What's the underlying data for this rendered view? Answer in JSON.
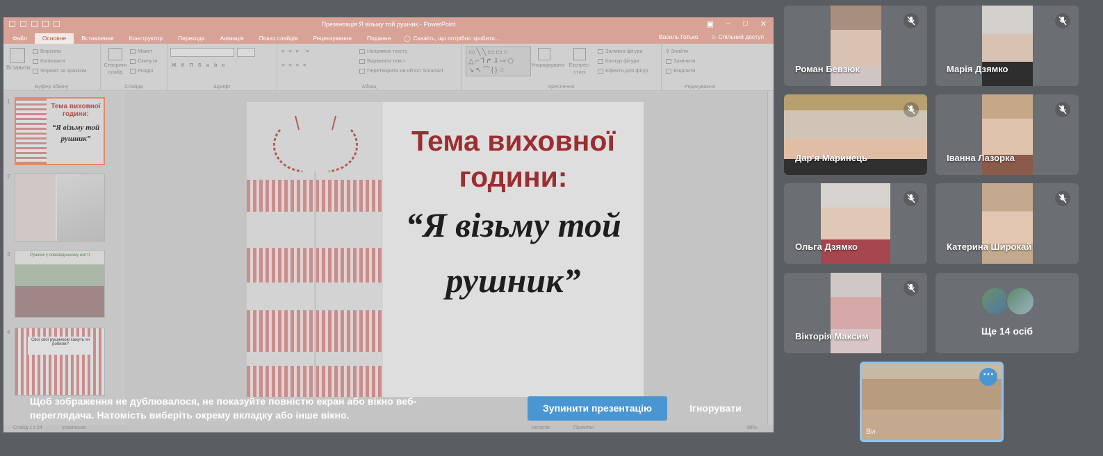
{
  "powerpoint": {
    "title": "Презентація Я візьму той рушник - PowerPoint",
    "tabs": [
      "Файл",
      "Основне",
      "Вставлення",
      "Конструктор",
      "Переходи",
      "Анімація",
      "Показ слайдів",
      "Рецензування",
      "Подання"
    ],
    "active_tab": "Основне",
    "tell_me": "Скажіть, що потрібно зробити...",
    "user": "Василь Готько",
    "share": "Спільний доступ",
    "ribbon": {
      "clipboard": {
        "paste": "Вставити",
        "cut": "Вирізати",
        "copy": "Копіювати",
        "format_painter": "Формат за зразком",
        "label": "Буфер обміну"
      },
      "slides": {
        "new_slide": "Створити слайд",
        "layout": "Макет",
        "reset": "Скинути",
        "section": "Розділ",
        "label": "Слайди"
      },
      "font": {
        "label": "Шрифт"
      },
      "paragraph": {
        "text_direction": "Напрямок тексту",
        "align_text": "Вирівняти текст",
        "convert_smartart": "Перетворити на об'єкт SmartArt",
        "label": "Абзац"
      },
      "drawing": {
        "arrange": "Упорядкувати",
        "quick_styles": "Експрес-стилі",
        "shape_fill": "Заливка фігури",
        "shape_outline": "Контур фігури",
        "shape_effects": "Ефекти для фігур",
        "label": "Креслення"
      },
      "editing": {
        "find": "Знайти",
        "replace": "Замінити",
        "select": "Виділити",
        "label": "Редагування"
      }
    },
    "slide_numbers": [
      "1",
      "2",
      "3",
      "4"
    ],
    "thumb1": {
      "title": "Тема виховної години:",
      "subtitle": "“Я візьму той рушник”"
    },
    "thumb3": {
      "caption": "Рушник у повсякденному житті"
    },
    "thumb4": {
      "caption": "Свої свої рушникові кажуть чи робили?"
    },
    "status": {
      "slide": "Слайд 1 з 24",
      "language": "українська",
      "notes": "Нотатки",
      "comments": "Примітки",
      "zoom": "86%"
    },
    "slide": {
      "title": "Тема виховної години:",
      "subtitle": "“Я візьму той рушник”"
    }
  },
  "share_banner": {
    "notice": "Щоб зображення не дублювалося, не показуйте повністю екран або вікно веб-переглядача. Натомість виберіть окрему вкладку або інше вікно.",
    "stop_button": "Зупинити презентацію",
    "ignore_button": "Ігнорувати"
  },
  "participants": [
    {
      "name": "Роман Бевзюк",
      "muted": true
    },
    {
      "name": "Марія Дзямко",
      "muted": true
    },
    {
      "name": "Дар'я Маринець",
      "muted": true
    },
    {
      "name": "Іванна Лазорка",
      "muted": true
    },
    {
      "name": "Ольга Дзямко",
      "muted": true
    },
    {
      "name": "Катерина Широкай",
      "muted": true
    },
    {
      "name": "Вікторія Максим",
      "muted": true
    }
  ],
  "more_participants": {
    "label": "Ще 14 осіб"
  },
  "self_view": {
    "options_icon": "more-horizontal-icon",
    "name": "Ви"
  },
  "colors": {
    "accent": "#4a96d2",
    "tile_bg": "#6b6e73",
    "slide_title": "#9b2e31",
    "ppt_titlebar": "#d8a396"
  }
}
